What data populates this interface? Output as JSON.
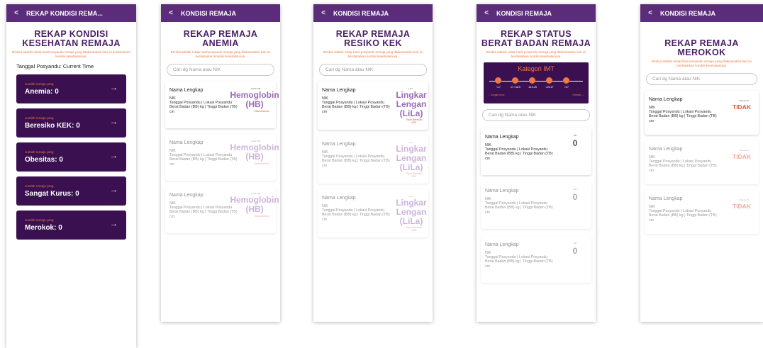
{
  "screen1": {
    "appbar_title": "REKAP KONDISI REMA...",
    "heading1": "REKAP KONDISI",
    "heading2": "KESEHATAN REMAJA",
    "subtitle": "Berikut adalah rekap hasil posyandu remaja yang dilaksanakan hari ini berdasarkan kondisi kesehatannya.",
    "time_label": "Tanggal Posyandu: Current Time",
    "buttons": [
      {
        "small": "Jumlah remaja yang",
        "label": "Anemia: 0"
      },
      {
        "small": "Jumlah remaja yang",
        "label": "Beresiko KEK: 0"
      },
      {
        "small": "Jumlah remaja yang",
        "label": "Obesitas: 0"
      },
      {
        "small": "Jumlah remaja yang",
        "label": "Sangat Kurus: 0"
      },
      {
        "small": "Jumlah remaja yang",
        "label": "Merokok: 0"
      }
    ],
    "arrow": "→"
  },
  "common": {
    "back": "<",
    "search_placeholder": "Cari dg Nama atau NIK",
    "card_name": "Nama Lengkap",
    "card_nik": "NIK",
    "card_info": "Tanggal Posyandu | Lokasi Posyandu",
    "card_measure": "Berat Badan (BB) kg | Tinggi Badan (TB) cm",
    "card_measure_short": "Berat Badan (BB) kg | Tinggi Badan (TB) cm"
  },
  "screen2": {
    "appbar_title": "KONDISI REMAJA",
    "heading1": "REKAP REMAJA",
    "heading2": "ANEMIA",
    "subtitle": "Berikut adalah rekap hasil posyandu remaja yang dilaksanakan hari ini berdasarkan kondisi kesehatannya.",
    "value_label": "Kadar HB",
    "value_big": "Hemoglobin (HB)",
    "value_status": "Tidak Anemia"
  },
  "screen3": {
    "appbar_title": "KONDISI REMAJA",
    "heading1": "REKAP REMAJA",
    "heading2": "RESIKO KEK",
    "subtitle": "Berikut adalah rekap hasil posyandu remaja yang dilaksanakan hari ini berdasarkan kondisi kesehatannya.",
    "value_label": "LiLa",
    "value_big": "Lingkar Lengan (LiLa)",
    "value_status": "Tidak Beresiko KEK"
  },
  "screen4": {
    "appbar_title": "KONDISI REMAJA",
    "heading1": "REKAP STATUS",
    "heading2": "BERAT BADAN REMAJA",
    "subtitle": "Berikut adalah rekap hasil posyandu remaja yang dilaksanakan hari ini berdasarkan kondisi kesehatannya.",
    "imt_title": "Kategori IMT",
    "imt_labels": [
      "<17",
      "17-<18.5",
      "18.5-25",
      ">25-27",
      ">27"
    ],
    "imt_left": "← Sangat Kurus",
    "imt_right": "Obesitas →",
    "value_label": "IMT",
    "value_big": "0"
  },
  "screen5": {
    "appbar_title": "KONDISI REMAJA",
    "heading1": "REKAP REMAJA",
    "heading2": "MEROKOK",
    "subtitle": "Berikut adalah rekap hasil posyandu remaja yang dilaksanakan hari ini berdasarkan kondisi kesehatannya.",
    "value_label": "Merokok?",
    "value_big": "TIDAK"
  },
  "colors": {
    "appbar": "#5b2c7a",
    "button_bg": "#3a1050",
    "accent_orange": "#f07840",
    "value_purple": "#9a6ab8"
  }
}
